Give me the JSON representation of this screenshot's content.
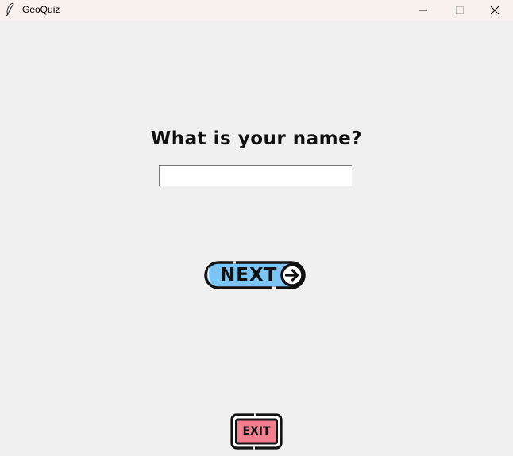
{
  "window": {
    "title": "GeoQuiz",
    "controls": [
      "minimize-icon",
      "maximize-icon",
      "close-icon"
    ]
  },
  "quiz": {
    "question": "What is your name?",
    "name_input_value": "",
    "name_input_placeholder": ""
  },
  "buttons": {
    "next_label": "NEXT",
    "next_icon": "arrow-right-circle-icon",
    "exit_label": "EXIT"
  },
  "colors": {
    "background": "#f0f0f0",
    "next_fill": "#7cc4f4",
    "exit_fill": "#f27e90",
    "outline": "#111111"
  }
}
